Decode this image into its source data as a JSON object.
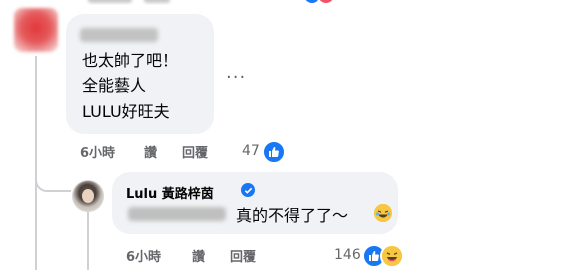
{
  "colors": {
    "accent": "#1877f2",
    "meta": "#65676b",
    "bubble": "#f0f2f5",
    "haha": "#f7c744"
  },
  "first_comment": {
    "lines": [
      "也太帥了吧！",
      "全能藝人",
      "LULU好旺夫"
    ],
    "time": "6小時",
    "like_label": "讚",
    "reply_label": "回覆",
    "reaction_count": "47",
    "more_menu": "..."
  },
  "reply_comment": {
    "author": "Lulu 黃路梓茵",
    "text": "真的不得了了～",
    "time": "6小時",
    "like_label": "讚",
    "reply_label": "回覆",
    "reaction_count": "146"
  },
  "icons": {
    "like": "thumbs-up-icon",
    "haha": "laughing-face-icon",
    "verified": "verified-badge-icon",
    "more": "more-options-icon"
  }
}
